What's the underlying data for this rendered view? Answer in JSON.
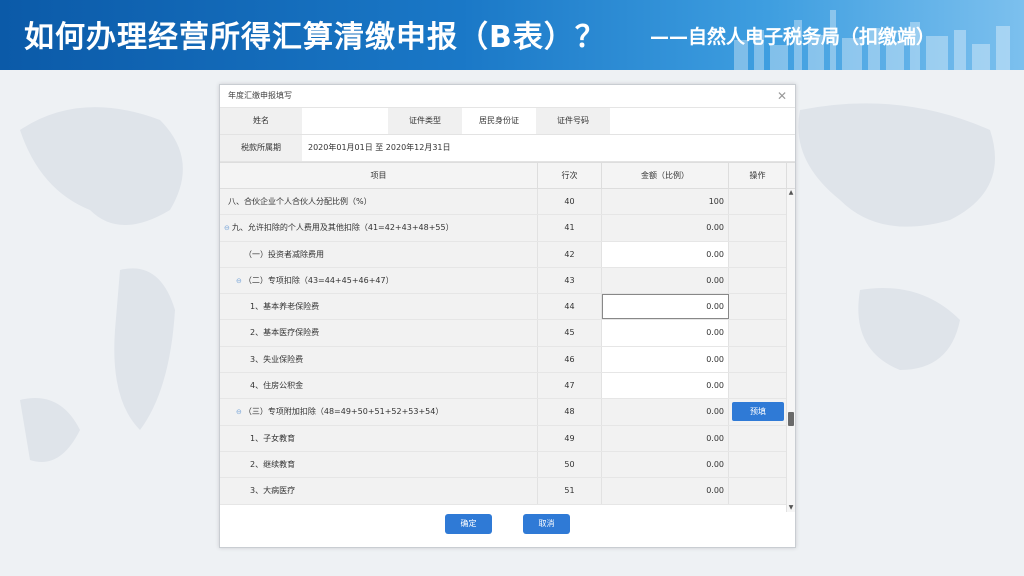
{
  "banner": {
    "title": "如何办理经营所得汇算清缴申报（B表）？",
    "subtitle": "——自然人电子税务局（扣缴端）"
  },
  "dialog": {
    "title": "年度汇缴申报填写",
    "info": {
      "name_label": "姓名",
      "name_value": "",
      "id_type_label": "证件类型",
      "id_type_value": "居民身份证",
      "id_number_label": "证件号码",
      "id_number_value": "",
      "period_label": "税款所属期",
      "period_value": "2020年01月01日 至 2020年12月31日"
    },
    "columns": [
      "项目",
      "行次",
      "金额（比例）",
      "操作"
    ],
    "rows": [
      {
        "item": "八、合伙企业个人合伙人分配比例（%）",
        "line": "40",
        "amount": "100",
        "action": ""
      },
      {
        "item": "九、允许扣除的个人费用及其他扣除（41=42+43+48+55）",
        "line": "41",
        "amount": "0.00",
        "action": ""
      },
      {
        "item": "（一）投资者减除费用",
        "line": "42",
        "amount": "0.00",
        "action": ""
      },
      {
        "item": "（二）专项扣除（43=44+45+46+47）",
        "line": "43",
        "amount": "0.00",
        "action": ""
      },
      {
        "item": "1、基本养老保险费",
        "line": "44",
        "amount": "0.00",
        "action": ""
      },
      {
        "item": "2、基本医疗保险费",
        "line": "45",
        "amount": "0.00",
        "action": ""
      },
      {
        "item": "3、失业保险费",
        "line": "46",
        "amount": "0.00",
        "action": ""
      },
      {
        "item": "4、住房公积金",
        "line": "47",
        "amount": "0.00",
        "action": ""
      },
      {
        "item": "（三）专项附加扣除（48=49+50+51+52+53+54）",
        "line": "48",
        "amount": "0.00",
        "action": "预填"
      },
      {
        "item": "1、子女教育",
        "line": "49",
        "amount": "0.00",
        "action": ""
      },
      {
        "item": "2、继续教育",
        "line": "50",
        "amount": "0.00",
        "action": ""
      },
      {
        "item": "3、大病医疗",
        "line": "51",
        "amount": "0.00",
        "action": ""
      }
    ],
    "buttons": {
      "ok": "确定",
      "cancel": "取消"
    }
  },
  "colors": {
    "accent": "#2f7ad6",
    "banner": "#1a78c7"
  }
}
